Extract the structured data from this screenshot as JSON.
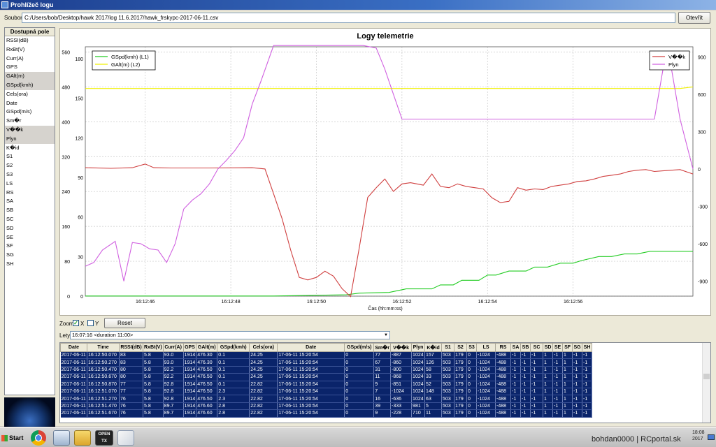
{
  "window": {
    "title": "Prohlížeč logu"
  },
  "file": {
    "label": "Soubor",
    "path": "C:/Users/bob/Desktop/hawk 2017/log 11.6.2017/hawk_frskypc-2017-06-11.csv",
    "open_label": "Otevřít"
  },
  "fields": {
    "header": "Dostupná pole",
    "items": [
      {
        "label": "RSSI(dB)",
        "selected": false
      },
      {
        "label": "RxBt(V)",
        "selected": false
      },
      {
        "label": "Curr(A)",
        "selected": false
      },
      {
        "label": "GPS",
        "selected": false
      },
      {
        "label": "GAlt(m)",
        "selected": true
      },
      {
        "label": "GSpd(kmh)",
        "selected": true
      },
      {
        "label": "Cels(ora)",
        "selected": false
      },
      {
        "label": "Date",
        "selected": false
      },
      {
        "label": "GSpd(m/s)",
        "selected": false
      },
      {
        "label": "Sm�r",
        "selected": false
      },
      {
        "label": "V��k",
        "selected": true
      },
      {
        "label": "Plyn",
        "selected": true
      },
      {
        "label": "K�id",
        "selected": false
      },
      {
        "label": "S1",
        "selected": false
      },
      {
        "label": "S2",
        "selected": false
      },
      {
        "label": "S3",
        "selected": false
      },
      {
        "label": "LS",
        "selected": false
      },
      {
        "label": "RS",
        "selected": false
      },
      {
        "label": "SA",
        "selected": false
      },
      {
        "label": "SB",
        "selected": false
      },
      {
        "label": "SC",
        "selected": false
      },
      {
        "label": "SD",
        "selected": false
      },
      {
        "label": "SE",
        "selected": false
      },
      {
        "label": "SF",
        "selected": false
      },
      {
        "label": "SG",
        "selected": false
      },
      {
        "label": "SH",
        "selected": false
      }
    ]
  },
  "chart_data": {
    "type": "line",
    "title": "Logy telemetrie",
    "xlabel": "Čas (hh:mm:ss)",
    "x_ticks": [
      "16:12:46",
      "16:12:48",
      "16:12:50",
      "16:12:52",
      "16:12:54",
      "16:12:56"
    ],
    "x_tick_seconds": [
      46,
      48,
      50,
      52,
      54,
      56
    ],
    "xlim": [
      44.6,
      58.8
    ],
    "y_left_outer": {
      "ticks": [
        0,
        80,
        160,
        240,
        320,
        400,
        480,
        560
      ],
      "ylim": [
        0,
        572
      ]
    },
    "y_left_inner": {
      "ticks": [
        0,
        30,
        60,
        90,
        120,
        150,
        180
      ],
      "ylim": [
        0,
        189
      ]
    },
    "y_right": {
      "ticks": [
        -900,
        -600,
        -300,
        0,
        300,
        600,
        900
      ],
      "ylim": [
        -1020,
        980
      ]
    },
    "legend_left": {
      "placement": "top-left",
      "entries": [
        "GSpd(kmh) (L1)",
        "GAlt(m) (L2)"
      ]
    },
    "legend_right": {
      "placement": "top-right",
      "entries": [
        "V��k",
        "Plyn"
      ]
    },
    "series": [
      {
        "name": "GSpd(kmh) (L1)",
        "axis": "left_inner",
        "color": "#22cc22",
        "x": [
          44.6,
          49.0,
          50.7,
          51.0,
          51.7,
          52.1,
          52.7,
          52.9,
          53.2,
          53.4,
          53.8,
          54.0,
          54.2,
          54.5,
          54.9,
          55.1,
          55.4,
          55.7,
          56.0,
          56.2,
          56.6,
          56.9,
          57.2,
          57.5,
          57.8,
          58.0,
          58.8
        ],
        "values": [
          0.1,
          0.1,
          1.0,
          2.3,
          2.8,
          5.5,
          5.5,
          8.5,
          8.5,
          12,
          12,
          16,
          16,
          19,
          19,
          22,
          22,
          25,
          25,
          27,
          30,
          30,
          32,
          32,
          34,
          34,
          34
        ]
      },
      {
        "name": "GAlt(m) (L2)",
        "axis": "left_outer",
        "color": "#f0f000",
        "x": [
          44.6,
          58.5,
          58.8
        ],
        "values": [
          476.4,
          476.4,
          480
        ]
      },
      {
        "name": "V��k",
        "axis": "right",
        "color": "#d04040",
        "x": [
          44.6,
          45.2,
          45.7,
          46.0,
          46.2,
          46.6,
          47.5,
          48.5,
          48.8,
          49.0,
          49.2,
          49.4,
          49.6,
          49.8,
          50.0,
          50.2,
          50.4,
          50.6,
          50.8,
          51.0,
          51.2,
          51.4,
          51.6,
          51.8,
          52.0,
          52.2,
          52.5,
          52.7,
          52.9,
          53.1,
          53.3,
          53.5,
          53.7,
          53.9,
          54.1,
          54.3,
          54.5,
          54.7,
          54.9,
          55.1,
          55.3,
          55.5,
          55.7,
          55.9,
          56.1,
          56.3,
          56.5,
          56.7,
          56.9,
          57.1,
          57.3,
          57.5,
          57.7,
          57.9,
          58.1,
          58.3,
          58.5,
          58.8
        ],
        "values": [
          10,
          5,
          10,
          40,
          10,
          8,
          8,
          10,
          0,
          -200,
          -400,
          -650,
          -870,
          -890,
          -870,
          -820,
          -860,
          -960,
          -1024,
          -636,
          -228,
          -150,
          -80,
          -180,
          -120,
          -110,
          -130,
          -40,
          -140,
          -150,
          -120,
          -140,
          -150,
          -160,
          -230,
          -270,
          -260,
          -150,
          -170,
          -160,
          -165,
          -140,
          -130,
          -120,
          -100,
          -95,
          -80,
          -60,
          -50,
          -40,
          -20,
          -10,
          -5,
          -20,
          -15,
          -10,
          -5,
          -40
        ]
      },
      {
        "name": "Plyn",
        "axis": "right",
        "color": "#d060e0",
        "x": [
          44.6,
          44.8,
          45.0,
          45.3,
          45.5,
          45.7,
          45.9,
          46.1,
          46.3,
          46.5,
          46.7,
          46.9,
          47.1,
          47.3,
          47.5,
          47.7,
          47.9,
          48.1,
          48.3,
          48.5,
          48.7,
          49.0,
          50.0,
          50.9,
          51.1,
          51.4,
          51.6,
          51.8,
          52.0,
          57.5,
          57.7,
          57.9,
          58.1,
          58.3,
          58.5,
          58.8
        ],
        "values": [
          -780,
          -750,
          -650,
          -580,
          -900,
          -590,
          -600,
          -640,
          -650,
          -750,
          -600,
          -320,
          -250,
          -200,
          -120,
          0,
          70,
          150,
          250,
          520,
          700,
          990,
          990,
          990,
          990,
          970,
          800,
          600,
          400,
          400,
          400,
          400,
          800,
          800,
          400,
          0
        ]
      }
    ]
  },
  "zoom": {
    "label": "Zoom",
    "x_label": "X",
    "y_label": "Y",
    "x_checked": true,
    "y_checked": false,
    "reset_label": "Reset"
  },
  "flights": {
    "label": "Lety",
    "selected": "16:07:16 <duration 11:00>"
  },
  "table": {
    "columns": [
      "Date",
      "Time",
      "RSSI(dB)",
      "RxBt(V)",
      "Curr(A)",
      "GPS",
      "GAlt(m)",
      "GSpd(kmh)",
      "Cels(ora)",
      "Date",
      "GSpd(m/s)",
      "Sm�r",
      "V��k",
      "Plyn",
      "K�id",
      "S1",
      "S2",
      "S3",
      "LS",
      "RS",
      "SA",
      "SB",
      "SC",
      "SD",
      "SE",
      "SF",
      "SG",
      "SH"
    ],
    "rows": [
      [
        "2017-06-11",
        "16:12:50.070",
        "83",
        "5.8",
        "93.0",
        "1914",
        "476.30",
        "0.1",
        "24.25",
        "17-06-11 15:20:54",
        "0",
        "77",
        "-887",
        "1024",
        "157",
        "503",
        "179",
        "0",
        "-1024",
        "-488",
        "-1",
        "-1",
        "-1",
        "1",
        "-1",
        "1",
        "-1",
        "-1"
      ],
      [
        "2017-06-11",
        "16:12:50.270",
        "83",
        "5.8",
        "93.0",
        "1914",
        "476.30",
        "0.1",
        "24.25",
        "17-06-11 15:20:54",
        "0",
        "67",
        "-860",
        "1024",
        "126",
        "503",
        "179",
        "0",
        "-1024",
        "-488",
        "-1",
        "-1",
        "-1",
        "1",
        "-1",
        "1",
        "-1",
        "-1"
      ],
      [
        "2017-06-11",
        "16:12:50.470",
        "80",
        "5.8",
        "92.2",
        "1914",
        "476.50",
        "0.1",
        "24.25",
        "17-06-11 15:20:54",
        "0",
        "31",
        "-800",
        "1024",
        "58",
        "503",
        "179",
        "0",
        "-1024",
        "-488",
        "-1",
        "-1",
        "-1",
        "1",
        "-1",
        "1",
        "-1",
        "-1"
      ],
      [
        "2017-06-11",
        "16:12:50.670",
        "80",
        "5.8",
        "92.2",
        "1914",
        "476.50",
        "0.1",
        "24.25",
        "17-06-11 15:20:54",
        "0",
        "11",
        "-868",
        "1024",
        "33",
        "503",
        "179",
        "0",
        "-1024",
        "-488",
        "-1",
        "-1",
        "-1",
        "1",
        "-1",
        "1",
        "-1",
        "-1"
      ],
      [
        "2017-06-11",
        "16:12:50.870",
        "77",
        "5.8",
        "92.8",
        "1914",
        "476.50",
        "0.1",
        "22.82",
        "17-06-11 15:20:54",
        "0",
        "9",
        "-851",
        "1024",
        "52",
        "503",
        "179",
        "0",
        "-1024",
        "-488",
        "-1",
        "-1",
        "-1",
        "1",
        "-1",
        "1",
        "-1",
        "-1"
      ],
      [
        "2017-06-11",
        "16:12:51.070",
        "77",
        "5.8",
        "92.8",
        "1914",
        "476.50",
        "2.3",
        "22.82",
        "17-06-11 15:20:54",
        "0",
        "7",
        "-1024",
        "1024",
        "148",
        "503",
        "179",
        "0",
        "-1024",
        "-488",
        "-1",
        "-1",
        "-1",
        "1",
        "-1",
        "1",
        "-1",
        "-1"
      ],
      [
        "2017-06-11",
        "16:12:51.270",
        "76",
        "5.8",
        "92.8",
        "1914",
        "476.50",
        "2.3",
        "22.82",
        "17-06-11 15:20:54",
        "0",
        "16",
        "-636",
        "1024",
        "63",
        "503",
        "179",
        "0",
        "-1024",
        "-488",
        "-1",
        "-1",
        "-1",
        "1",
        "-1",
        "1",
        "-1",
        "-1"
      ],
      [
        "2017-06-11",
        "16:12:51.470",
        "76",
        "5.8",
        "89.7",
        "1914",
        "476.60",
        "2.8",
        "22.82",
        "17-06-11 15:20:54",
        "0",
        "39",
        "-333",
        "981",
        "5",
        "503",
        "179",
        "0",
        "-1024",
        "-488",
        "-1",
        "-1",
        "-1",
        "1",
        "-1",
        "1",
        "-1",
        "-1"
      ],
      [
        "2017-06-11",
        "16:12:51.670",
        "76",
        "5.8",
        "89.7",
        "1914",
        "476.60",
        "2.8",
        "22.82",
        "17-06-11 15:20:54",
        "0",
        "9",
        "-228",
        "710",
        "11",
        "503",
        "179",
        "0",
        "-1024",
        "-488",
        "-1",
        "-1",
        "-1",
        "1",
        "-1",
        "1",
        "-1",
        "-1"
      ]
    ]
  },
  "taskbar": {
    "start_label": "Start",
    "opentx_label": "OPEN TX",
    "tray_text": "bohdan0000 | RCportal.sk",
    "clock_time": "18:08",
    "clock_date": "2017"
  }
}
